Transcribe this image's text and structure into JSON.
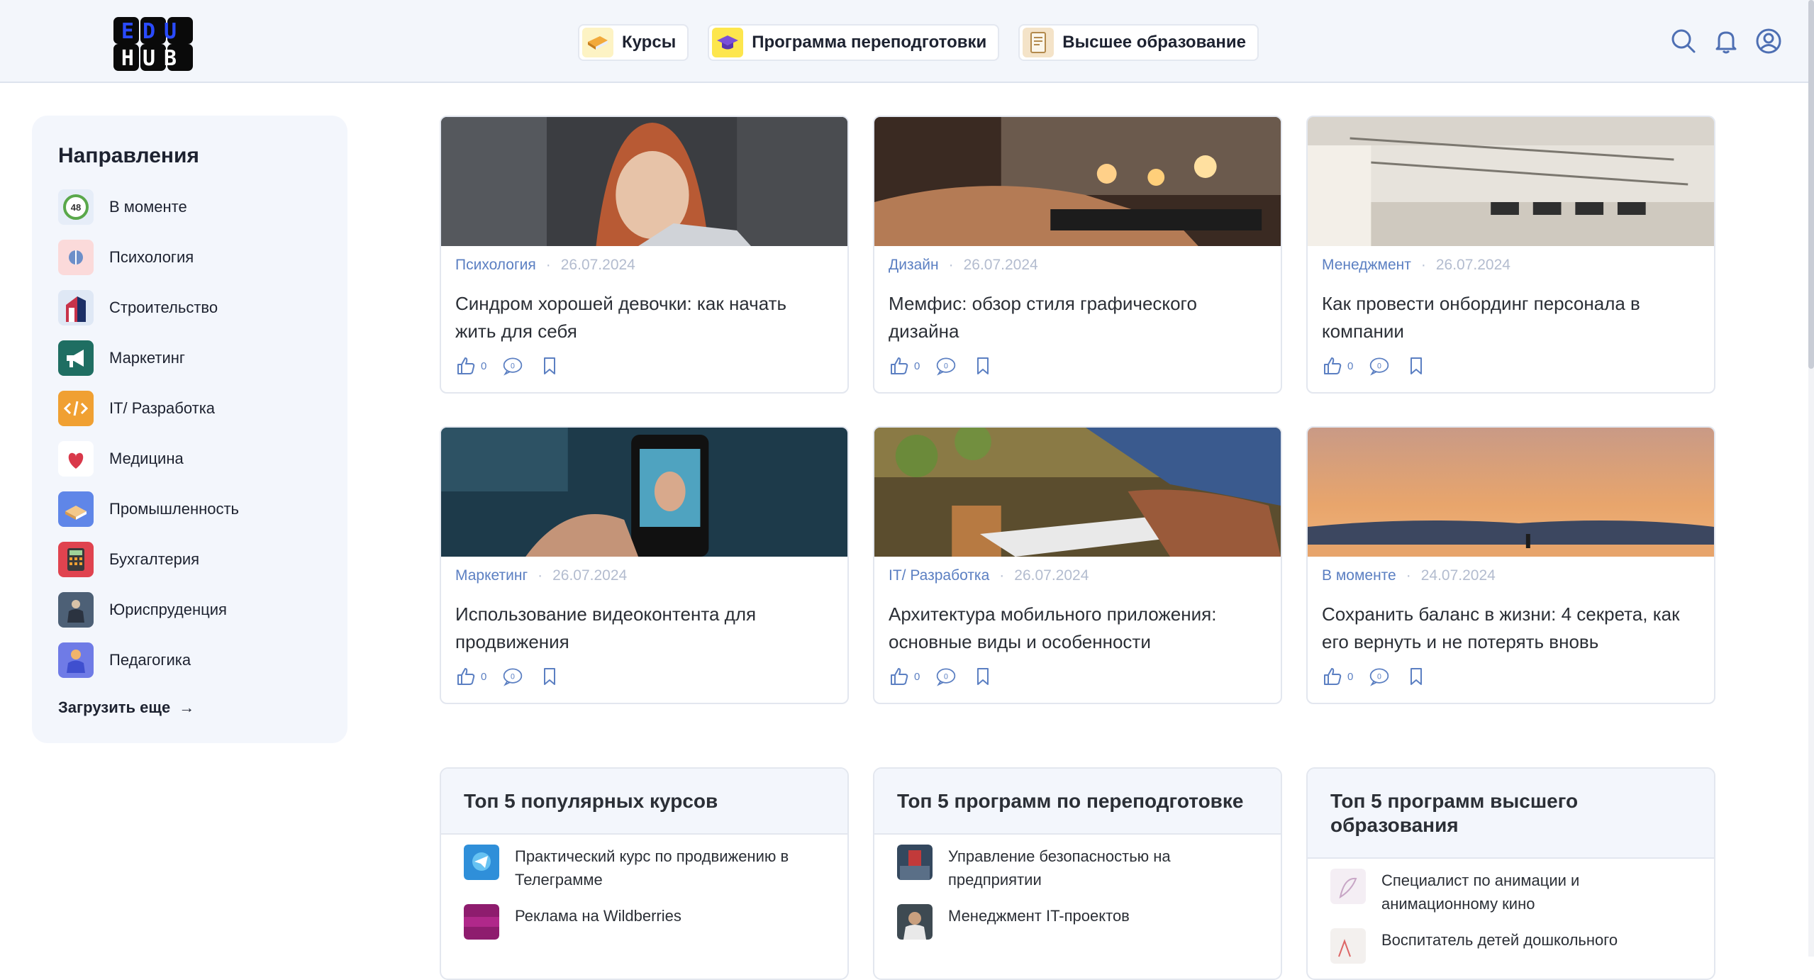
{
  "header": {
    "logo_text_top": "EDU",
    "logo_text_bottom": "HUB",
    "nav": [
      {
        "label": "Курсы",
        "icon": "book-icon"
      },
      {
        "label": "Программа переподготовки",
        "icon": "graduation-cap-icon"
      },
      {
        "label": "Высшее образование",
        "icon": "diploma-icon"
      }
    ],
    "icons": [
      "search-icon",
      "bell-icon",
      "user-icon"
    ]
  },
  "sidebar": {
    "title": "Направления",
    "items": [
      {
        "label": "В моменте",
        "icon": "clock-48-icon"
      },
      {
        "label": "Психология",
        "icon": "brain-icon"
      },
      {
        "label": "Строительство",
        "icon": "building-icon"
      },
      {
        "label": "Маркетинг",
        "icon": "megaphone-icon"
      },
      {
        "label": "IT/ Разработка",
        "icon": "code-icon"
      },
      {
        "label": "Медицина",
        "icon": "heart-icon"
      },
      {
        "label": "Промышленность",
        "icon": "factory-icon"
      },
      {
        "label": "Бухгалтерия",
        "icon": "calculator-icon"
      },
      {
        "label": "Юриспруденция",
        "icon": "lawyer-icon"
      },
      {
        "label": "Педагогика",
        "icon": "teacher-icon"
      }
    ],
    "load_more": "Загрузить еще",
    "load_more_arrow": "→"
  },
  "articles": [
    {
      "category": "Психология",
      "date": "26.07.2024",
      "title": "Синдром хорошей девочки: как начать жить для себя",
      "likes": "0",
      "comments": "0"
    },
    {
      "category": "Дизайн",
      "date": "26.07.2024",
      "title": "Мемфис: обзор стиля графического дизайна",
      "likes": "0",
      "comments": "0"
    },
    {
      "category": "Менеджмент",
      "date": "26.07.2024",
      "title": "Как провести онбординг персонала в компании",
      "likes": "0",
      "comments": "0"
    },
    {
      "category": "Маркетинг",
      "date": "26.07.2024",
      "title": "Использование видеоконтента для продвижения",
      "likes": "0",
      "comments": "0"
    },
    {
      "category": "IT/ Разработка",
      "date": "26.07.2024",
      "title": "Архитектура мобильного приложения: основные виды и особенности",
      "likes": "0",
      "comments": "0"
    },
    {
      "category": "В моменте",
      "date": "24.07.2024",
      "title": "Сохранить баланс в жизни: 4 секрета, как его вернуть и не потерять вновь",
      "likes": "0",
      "comments": "0"
    }
  ],
  "tops": [
    {
      "title": "Топ 5 популярных курсов",
      "items": [
        "Практический курс по продвижению в Телеграмме",
        "Реклама на Wildberries"
      ]
    },
    {
      "title": "Топ 5 программ по переподготовке",
      "items": [
        "Управление безопасностью на предприятии",
        "Менеджмент IT-проектов"
      ]
    },
    {
      "title": "Топ 5 программ высшего образования",
      "items": [
        "Специалист по анимации и анимационному кино",
        "Воспитатель детей дошкольного"
      ]
    }
  ],
  "colors": {
    "accent": "#5b7fc2",
    "header_bg": "#f3f6fb",
    "sidebar_bg": "#f3f6fc",
    "date": "#b3bccf"
  }
}
